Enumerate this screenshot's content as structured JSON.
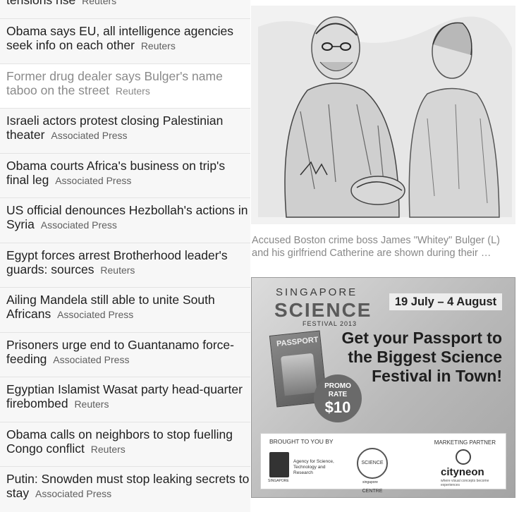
{
  "news": [
    {
      "headline": "tensions rise",
      "source": "Reuters"
    },
    {
      "headline": "Obama says EU, all intelligence agencies seek info on each other",
      "source": "Reuters"
    },
    {
      "headline": "Former drug dealer says Bulger's name taboo on the street",
      "source": "Reuters"
    },
    {
      "headline": "Israeli actors protest closing Palestinian theater",
      "source": "Associated Press"
    },
    {
      "headline": "Obama courts Africa's business on trip's final leg",
      "source": "Associated Press"
    },
    {
      "headline": "US official denounces Hezbollah's actions in Syria",
      "source": "Associated Press"
    },
    {
      "headline": "Egypt forces arrest Brotherhood leader's guards: sources",
      "source": "Reuters"
    },
    {
      "headline": "Ailing Mandela still able to unite South Africans",
      "source": "Associated Press"
    },
    {
      "headline": "Prisoners urge end to Guantanamo force-feeding",
      "source": "Associated Press"
    },
    {
      "headline": "Egyptian Islamist Wasat party head-quarter firebombed",
      "source": "Reuters"
    },
    {
      "headline": "Obama calls on neighbors to stop fuelling Congo conflict",
      "source": "Reuters"
    },
    {
      "headline": "Putin: Snowden must stop leaking secrets to stay",
      "source": "Associated Press"
    }
  ],
  "feature": {
    "caption": "Accused Boston crime boss James \"Whitey\" Bulger (L) and his girlfriend Catherine are shown during their …"
  },
  "ad": {
    "logo_top": "SINGAPORE",
    "logo_main": "SCIENCE",
    "logo_sub": "FESTIVAL 2013",
    "dates": "19 July – 4 August",
    "headline": "Get your Passport to the Biggest Science Festival in Town!",
    "passport_label": "PASSPORT",
    "promo_line1": "PROMO",
    "promo_line2": "RATE",
    "promo_price": "$10",
    "brought_by": "BROUGHT TO YOU BY",
    "marketing_partner": "MARKETING PARTNER",
    "astar_text": "Agency for Science, Technology and Research",
    "astar_sub": "SINGAPORE",
    "science_centre": "SCIENCE CENTRE",
    "science_centre_sub": "singapore",
    "partner_name": "cityneon",
    "partner_tag": "where visual concepts become experiences"
  }
}
